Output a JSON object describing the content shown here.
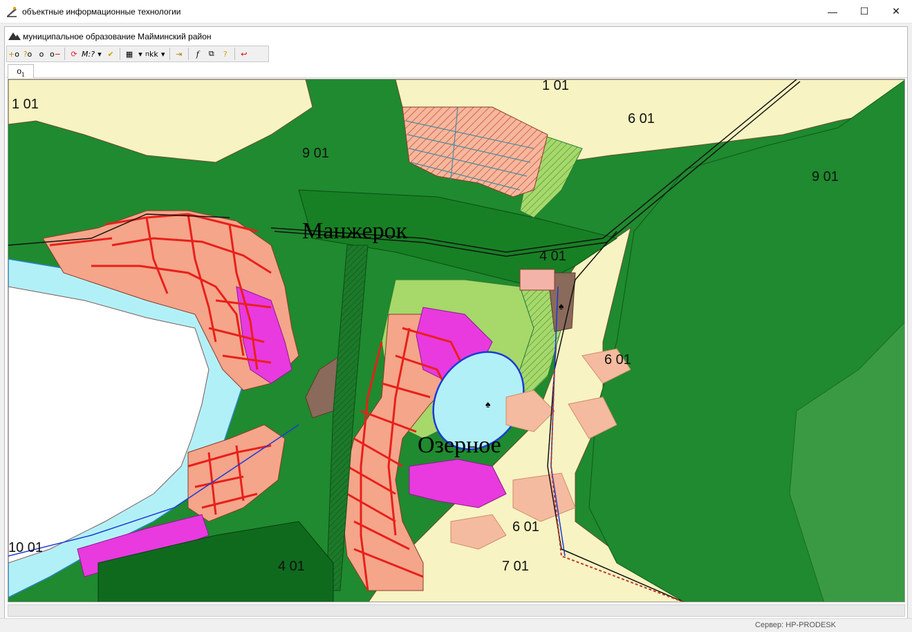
{
  "window": {
    "title": "объектные информационные технологии",
    "minimize_icon": "minimize-icon",
    "maximize_icon": "maximize-icon",
    "close_icon": "close-icon"
  },
  "document": {
    "title": "муниципальное образование Майминский район"
  },
  "toolbar": {
    "buttons": [
      {
        "name": "add-object-icon",
        "glyph": "+o"
      },
      {
        "name": "query-object-icon",
        "glyph": "?o"
      },
      {
        "name": "object-icon",
        "glyph": "o"
      },
      {
        "name": "remove-object-icon",
        "glyph": "o−"
      },
      {
        "name": "refresh-icon",
        "glyph": "⟳"
      },
      {
        "name": "measure-icon",
        "glyph": "M:?"
      },
      {
        "name": "check-icon",
        "glyph": "✔"
      },
      {
        "name": "grid-icon",
        "glyph": "▦"
      },
      {
        "name": "coordinates-icon",
        "glyph": "ⁿkk"
      },
      {
        "name": "export-icon",
        "glyph": "⇥"
      },
      {
        "name": "function-icon",
        "glyph": "f"
      },
      {
        "name": "layers-icon",
        "glyph": "⧉"
      },
      {
        "name": "help-icon",
        "glyph": "?"
      },
      {
        "name": "return-icon",
        "glyph": "↩"
      }
    ]
  },
  "tabs": [
    {
      "label": "o",
      "sub": "1"
    }
  ],
  "map": {
    "place_labels": [
      "Манжерок",
      "Озерное"
    ],
    "zone_labels": [
      "1 01",
      "9 01",
      "1 01",
      "6 01",
      "9 01",
      "4 01",
      "6 01",
      "6 01",
      "10 01",
      "4 01",
      "7 01"
    ],
    "colors": {
      "forest_dark": "#1f8a2f",
      "forest": "#3aa048",
      "meadow": "#a8d86a",
      "light_yellow": "#f7f3c2",
      "water": "#b2f0f7",
      "lake_white": "#ffffff",
      "residential": "#f4a58a",
      "industrial": "#e83adf",
      "roads": "#e8201a",
      "brown": "#8a6a5a"
    }
  },
  "status": {
    "server": "Сервер: HP-PRODESK"
  }
}
